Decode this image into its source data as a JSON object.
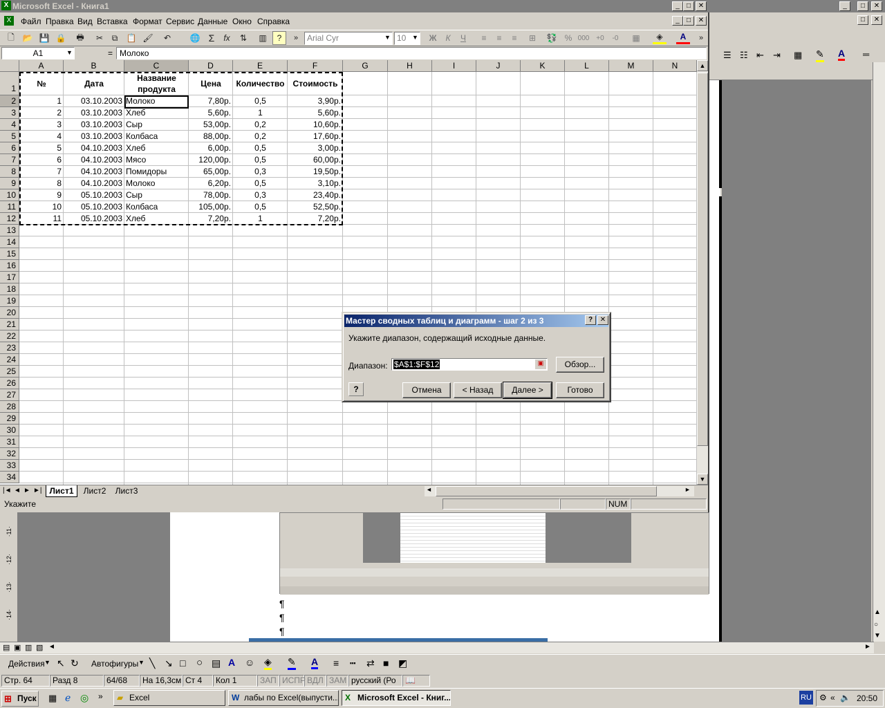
{
  "excel": {
    "title": "Microsoft Excel - Книга1",
    "menu": [
      "Файл",
      "Правка",
      "Вид",
      "Вставка",
      "Формат",
      "Сервис",
      "Данные",
      "Окно",
      "Справка"
    ],
    "font_name": "Arial Cyr",
    "font_size": "10",
    "name_box": "A1",
    "formula_eq": "=",
    "formula_value": "Молоко",
    "columns": [
      "A",
      "B",
      "C",
      "D",
      "E",
      "F",
      "G",
      "H",
      "I",
      "J",
      "K",
      "L",
      "M",
      "N"
    ],
    "header_row": {
      "num": "№",
      "date": "Дата",
      "product": "Название продукта",
      "price": "Цена",
      "qty": "Количество",
      "cost": "Стоимость"
    },
    "rows": [
      [
        "1",
        "03.10.2003",
        "Молоко",
        "7,80р.",
        "0,5",
        "3,90р."
      ],
      [
        "2",
        "03.10.2003",
        "Хлеб",
        "5,60р.",
        "1",
        "5,60р."
      ],
      [
        "3",
        "03.10.2003",
        "Сыр",
        "53,00р.",
        "0,2",
        "10,60р."
      ],
      [
        "4",
        "03.10.2003",
        "Колбаса",
        "88,00р.",
        "0,2",
        "17,60р."
      ],
      [
        "5",
        "04.10.2003",
        "Хлеб",
        "6,00р.",
        "0,5",
        "3,00р."
      ],
      [
        "6",
        "04.10.2003",
        "Мясо",
        "120,00р.",
        "0,5",
        "60,00р."
      ],
      [
        "7",
        "04.10.2003",
        "Помидоры",
        "65,00р.",
        "0,3",
        "19,50р."
      ],
      [
        "8",
        "04.10.2003",
        "Молоко",
        "6,20р.",
        "0,5",
        "3,10р."
      ],
      [
        "9",
        "05.10.2003",
        "Сыр",
        "78,00р.",
        "0,3",
        "23,40р."
      ],
      [
        "10",
        "05.10.2003",
        "Колбаса",
        "105,00р.",
        "0,5",
        "52,50р."
      ],
      [
        "11",
        "05.10.2003",
        "Хлеб",
        "7,20р.",
        "1",
        "7,20р."
      ]
    ],
    "sheets": [
      "Лист1",
      "Лист2",
      "Лист3"
    ],
    "status_left": "Укажите",
    "status_num": "NUM"
  },
  "dialog": {
    "title": "Мастер сводных таблиц и диаграмм - шаг 2 из 3",
    "prompt": "Укажите диапазон, содержащий исходные данные.",
    "range_label": "Диапазон:",
    "range_value": "$A$1:$F$12",
    "browse": "Обзор...",
    "cancel": "Отмена",
    "back": "< Назад",
    "next": "Далее >",
    "finish": "Готово"
  },
  "word": {
    "draw_actions": "Действия",
    "autoshapes": "Автофигуры",
    "status": {
      "page": "Стр. 64",
      "section": "Разд 8",
      "pages": "64/68",
      "at": "На 16,3см",
      "line": "Ст 4",
      "col": "Кол 1",
      "zap": "ЗАП",
      "ispr": "ИСПР",
      "vdl": "ВДЛ",
      "zam": "ЗАМ",
      "lang": "русский (Ро"
    }
  },
  "taskbar": {
    "start": "Пуск",
    "items": [
      "Excel",
      "лабы по Excel(выпусти...",
      "Microsoft Excel - Книг..."
    ],
    "lang": "RU",
    "time": "20:50"
  },
  "colors": {
    "title_active": "#0a246a",
    "title_inactive": "#808080",
    "face": "#d4d0c8"
  }
}
